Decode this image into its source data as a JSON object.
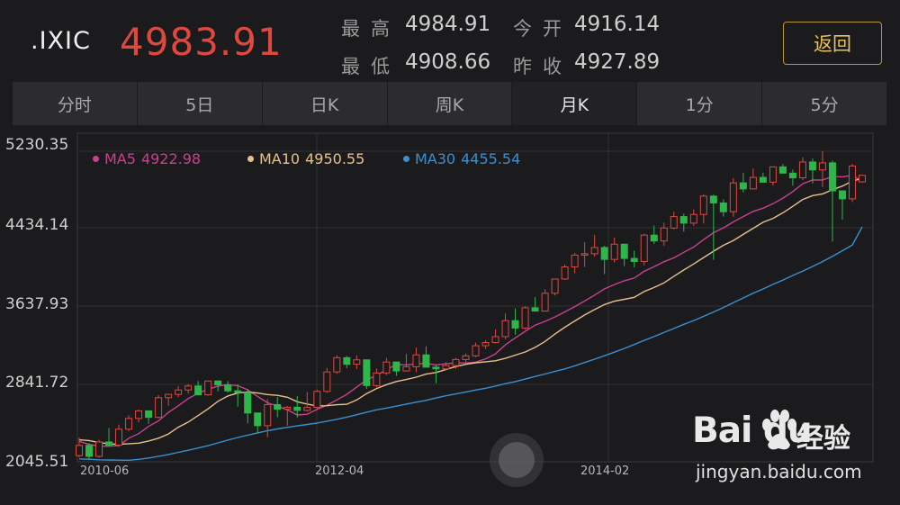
{
  "header": {
    "symbol": ".IXIC",
    "price": "4983.91",
    "high_label": "最高",
    "high_value": "4984.91",
    "open_label": "今开",
    "open_value": "4916.14",
    "low_label": "最低",
    "low_value": "4908.66",
    "prev_close_label": "昨收",
    "prev_close_value": "4927.89",
    "back_label": "返回"
  },
  "tabs": [
    {
      "label": "分时"
    },
    {
      "label": "5日"
    },
    {
      "label": "日K"
    },
    {
      "label": "周K"
    },
    {
      "label": "月K"
    },
    {
      "label": "1分"
    },
    {
      "label": "5分"
    }
  ],
  "active_tab": 4,
  "colors": {
    "up": "#e0473e",
    "down": "#2fb64b",
    "ma5": "#c8418e",
    "ma10": "#e6c08a",
    "ma30": "#3a8fd0",
    "accent": "#e8c15a"
  },
  "legend": [
    {
      "name": "MA5",
      "value": "4922.98"
    },
    {
      "name": "MA10",
      "value": "4950.55"
    },
    {
      "name": "MA30",
      "value": "4455.54"
    }
  ],
  "chart_data": {
    "type": "candlestick",
    "y_tick_labels": [
      "5230.35",
      "4434.14",
      "3637.93",
      "2841.72",
      "2045.51"
    ],
    "ylim": [
      2045.51,
      5230.35
    ],
    "x_tick_labels": [
      "2010-06",
      "2012-04",
      "2014-02"
    ],
    "grid": true,
    "candles": [
      [
        2109,
        2294,
        2091,
        2213
      ],
      [
        2213,
        2236,
        2061,
        2101
      ],
      [
        2101,
        2271,
        2087,
        2249
      ],
      [
        2249,
        2392,
        2207,
        2216
      ],
      [
        2216,
        2427,
        2198,
        2380
      ],
      [
        2380,
        2522,
        2360,
        2490
      ],
      [
        2490,
        2580,
        2452,
        2568
      ],
      [
        2568,
        2556,
        2434,
        2501
      ],
      [
        2501,
        2730,
        2491,
        2703
      ],
      [
        2703,
        2741,
        2620,
        2737
      ],
      [
        2737,
        2822,
        2708,
        2782
      ],
      [
        2782,
        2843,
        2745,
        2823
      ],
      [
        2823,
        2874,
        2730,
        2732
      ],
      [
        2732,
        2874,
        2722,
        2874
      ],
      [
        2874,
        2878,
        2769,
        2835
      ],
      [
        2835,
        2873,
        2755,
        2773
      ],
      [
        2773,
        2840,
        2611,
        2756
      ],
      [
        2756,
        2792,
        2438,
        2546
      ],
      [
        2546,
        2543,
        2335,
        2416
      ],
      [
        2416,
        2690,
        2298,
        2632
      ],
      [
        2632,
        2710,
        2503,
        2584
      ],
      [
        2584,
        2617,
        2416,
        2605
      ],
      [
        2605,
        2719,
        2499,
        2573
      ],
      [
        2573,
        2761,
        2559,
        2603
      ],
      [
        2603,
        2785,
        2590,
        2767
      ],
      [
        2767,
        3008,
        2753,
        2967
      ],
      [
        2967,
        3137,
        2948,
        3113
      ],
      [
        3113,
        3130,
        3005,
        3046
      ],
      [
        3046,
        3138,
        2995,
        3091
      ],
      [
        3091,
        3085,
        2793,
        2827
      ],
      [
        2827,
        3002,
        2810,
        2956
      ],
      [
        2956,
        3110,
        2934,
        3069
      ],
      [
        3069,
        3056,
        2926,
        2977
      ],
      [
        2977,
        3153,
        2976,
        3020
      ],
      [
        3020,
        3216,
        2964,
        3142
      ],
      [
        3142,
        3229,
        3080,
        3016
      ],
      [
        3016,
        3035,
        2852,
        2999
      ],
      [
        2999,
        3066,
        2983,
        3032
      ],
      [
        3032,
        3112,
        2999,
        3094
      ],
      [
        3094,
        3156,
        3067,
        3132
      ],
      [
        3132,
        3267,
        3118,
        3236
      ],
      [
        3236,
        3293,
        3204,
        3268
      ],
      [
        3268,
        3404,
        3259,
        3329
      ],
      [
        3329,
        3568,
        3301,
        3493
      ],
      [
        3493,
        3618,
        3350,
        3417
      ],
      [
        3417,
        3640,
        3404,
        3625
      ],
      [
        3625,
        3734,
        3600,
        3591
      ],
      [
        3591,
        3813,
        3586,
        3774
      ],
      [
        3774,
        3923,
        3751,
        3920
      ],
      [
        3920,
        4069,
        3912,
        4044
      ],
      [
        4044,
        4188,
        3979,
        4165
      ],
      [
        4165,
        4298,
        4043,
        4179
      ],
      [
        4179,
        4372,
        4150,
        4243
      ],
      [
        4243,
        4259,
        3970,
        4121
      ],
      [
        4121,
        4344,
        4090,
        4277
      ],
      [
        4277,
        4282,
        4052,
        4131
      ],
      [
        4131,
        4210,
        4040,
        4100
      ],
      [
        4100,
        4384,
        4060,
        4370
      ],
      [
        4370,
        4469,
        4280,
        4310
      ],
      [
        4310,
        4499,
        4262,
        4443
      ],
      [
        4443,
        4610,
        4427,
        4560
      ],
      [
        4560,
        4590,
        4406,
        4493
      ],
      [
        4493,
        4633,
        4465,
        4582
      ],
      [
        4582,
        4787,
        4488,
        4770
      ],
      [
        4770,
        4785,
        4117,
        4700
      ],
      [
        4700,
        4736,
        4561,
        4610
      ],
      [
        4610,
        4955,
        4560,
        4906
      ],
      [
        4906,
        5009,
        4808,
        4844
      ],
      [
        4844,
        5053,
        4843,
        4962
      ],
      [
        4962,
        5010,
        4920,
        4913
      ],
      [
        4913,
        5072,
        4880,
        5070
      ],
      [
        5070,
        5100,
        5000,
        5006
      ],
      [
        5006,
        5043,
        4876,
        4958
      ],
      [
        4958,
        5167,
        4934,
        5120
      ],
      [
        5120,
        5155,
        4900,
        5039
      ],
      [
        5039,
        5231,
        4863,
        5111
      ],
      [
        5111,
        5135,
        4303,
        4824
      ],
      [
        4824,
        4810,
        4530,
        4742
      ],
      [
        4742,
        5100,
        4710,
        5079
      ],
      [
        4916,
        4985,
        4909,
        4984
      ]
    ],
    "series": [
      {
        "name": "MA5",
        "values": [
          2255,
          2224,
          2205,
          2205,
          2211,
          2287,
          2334,
          2408,
          2465,
          2551,
          2620,
          2694,
          2750,
          2790,
          2822,
          2838,
          2826,
          2784,
          2716,
          2651,
          2617,
          2578,
          2526,
          2533,
          2584,
          2626,
          2680,
          2737,
          2813,
          2886,
          2932,
          2989,
          3045,
          3039,
          3049,
          3055,
          3038,
          3051,
          3059,
          3059,
          3067,
          3101,
          3151,
          3245,
          3317,
          3384,
          3447,
          3486,
          3531,
          3583,
          3637,
          3694,
          3755,
          3819,
          3863,
          3902,
          3930,
          3999,
          4045,
          4097,
          4137,
          4194,
          4248,
          4324,
          4395,
          4445,
          4506,
          4560,
          4614,
          4646,
          4692,
          4749,
          4817,
          4897,
          4935,
          4936,
          4970,
          4968,
          4983,
          4923
        ]
      },
      {
        "name": "MA10",
        "values": [
          2271,
          2263,
          2243,
          2229,
          2225,
          2231,
          2237,
          2259,
          2287,
          2331,
          2400,
          2453,
          2520,
          2588,
          2666,
          2720,
          2751,
          2761,
          2751,
          2735,
          2727,
          2707,
          2661,
          2637,
          2619,
          2621,
          2631,
          2635,
          2680,
          2745,
          2797,
          2837,
          2869,
          2889,
          2913,
          2945,
          2961,
          2993,
          3022,
          3045,
          3061,
          3071,
          3081,
          3106,
          3139,
          3172,
          3219,
          3280,
          3355,
          3426,
          3489,
          3551,
          3607,
          3658,
          3692,
          3712,
          3732,
          3791,
          3833,
          3880,
          3948,
          4013,
          4075,
          4140,
          4205,
          4266,
          4315,
          4377,
          4440,
          4502,
          4542,
          4599,
          4665,
          4736,
          4775,
          4793,
          4835,
          4873,
          4925,
          4951
        ]
      },
      {
        "name": "MA30",
        "values": [
          2075,
          2071,
          2066,
          2064,
          2062,
          2061,
          2070,
          2084,
          2102,
          2120,
          2142,
          2164,
          2187,
          2211,
          2239,
          2268,
          2295,
          2319,
          2342,
          2364,
          2382,
          2399,
          2414,
          2429,
          2443,
          2462,
          2481,
          2503,
          2528,
          2554,
          2578,
          2597,
          2616,
          2637,
          2657,
          2675,
          2700,
          2722,
          2742,
          2762,
          2781,
          2800,
          2822,
          2847,
          2868,
          2894,
          2921,
          2946,
          2972,
          2998,
          3030,
          3064,
          3098,
          3133,
          3170,
          3208,
          3248,
          3290,
          3330,
          3371,
          3413,
          3455,
          3494,
          3537,
          3582,
          3628,
          3677,
          3726,
          3775,
          3818,
          3865,
          3909,
          3956,
          4001,
          4049,
          4099,
          4153,
          4210,
          4268,
          4455
        ]
      }
    ]
  }
}
